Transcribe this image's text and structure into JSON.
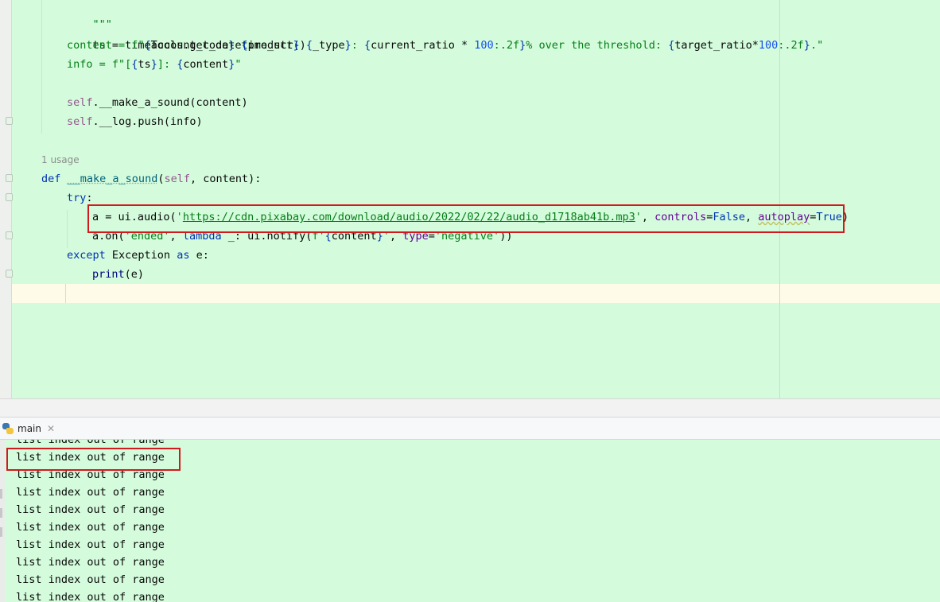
{
  "editor": {
    "code_lines": {
      "doc_end": "\"\"\"",
      "ts_line": [
        "ts = timeTools.get_datetime_str()"
      ],
      "content_line": {
        "p1": "content = f\"",
        "b1": "{",
        "v1": "account_code",
        "b2": "}",
        "s1": " ",
        "b3": "{",
        "v2": "product",
        "b4": "}",
        "s2": " ",
        "b5": "{",
        "v3": "_type",
        "b6": "}",
        "s3": ": ",
        "b7": "{",
        "v4": "current_ratio * ",
        "n1": "100",
        "f1": ":.2f",
        "b8": "}",
        "s4": "% over the threshold: ",
        "b9": "{",
        "v5": "target_ratio*",
        "n2": "100",
        "f2": ":.2f",
        "b10": "}",
        "s5": ".\""
      },
      "info_line": {
        "p1": "info = f\"[",
        "b1": "{",
        "v1": "ts",
        "b2": "}",
        "s1": "]: ",
        "b3": "{",
        "v2": "content",
        "b4": "}",
        "s2": "\""
      },
      "sound_line": {
        "self": "self",
        "rest": ".__make_a_sound(content)"
      },
      "push_line": {
        "self": "self",
        "rest": ".__log.push(info)"
      },
      "usage_hint": "1 usage",
      "def_line": {
        "kw": "def",
        "name": "__make_a_sound",
        "p1": "(",
        "self": "self",
        "rest": ", content):"
      },
      "try_line": {
        "kw": "try",
        "rest": ":"
      },
      "audio_line": {
        "p1": "a = ui.audio(",
        "q1": "'",
        "url": "https://cdn.pixabay.com/download/audio/2022/02/22/audio_d1718ab41b.mp3",
        "q2": "'",
        "c1": ", ",
        "a1": "controls",
        "e1": "=",
        "k1": "False",
        "c2": ", ",
        "a2": "autoplay",
        "e2": "=",
        "k2": "True",
        "end": ")"
      },
      "on_line": {
        "p1": "a.on(",
        "s1": "'ended'",
        "c1": ", ",
        "kw": "lambda",
        "p2": " _: ui.notify(",
        "s2": "f'",
        "b1": "{",
        "v1": "content",
        "b2": "}",
        "s3": "'",
        "c2": ", ",
        "a1": "type",
        "e1": "=",
        "s4": "'negative'",
        "end": "))"
      },
      "except_line": {
        "kw1": "except",
        "cls": " Exception ",
        "kw2": "as",
        "rest": " e:"
      },
      "print_line": {
        "fn": "print",
        "rest": "(e)"
      }
    }
  },
  "run_panel": {
    "tab_label": "main",
    "output_lines": [
      "list index out of range",
      "list index out of range",
      "list index out of range",
      "list index out of range",
      "list index out of range",
      "list index out of range",
      "list index out of range",
      "list index out of range",
      "list index out of range",
      "list index out of range"
    ]
  },
  "colors": {
    "background": "#d4fcdc",
    "highlight_box": "#d2191e",
    "keyword": "#0033b3",
    "string": "#067d17",
    "number": "#1750eb",
    "self": "#94558d"
  }
}
